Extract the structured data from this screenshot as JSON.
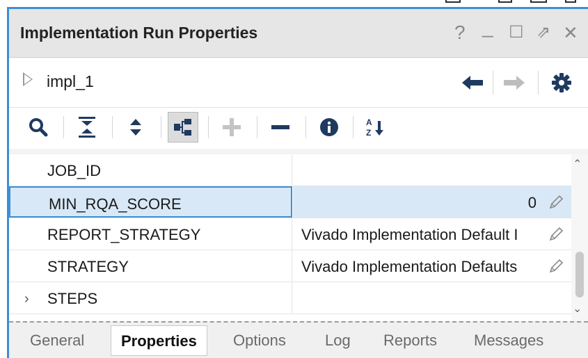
{
  "window": {
    "title": "Implementation Run Properties",
    "help_glyph": "?",
    "minimize_glyph": "_",
    "maximize_glyph": "☐",
    "restore_glyph": "⇗",
    "close_glyph": "✕"
  },
  "header": {
    "run_name": "impl_1",
    "icons": [
      "back-arrow-icon",
      "forward-arrow-icon",
      "gear-icon"
    ]
  },
  "toolbar": {
    "icons": [
      "search-icon",
      "collapse-all-icon",
      "expand-all-icon",
      "group-tree-icon",
      "add-icon",
      "remove-icon",
      "info-icon",
      "sort-alpha-icon"
    ],
    "sort_glyph_top": "A",
    "sort_glyph_bottom": "Z"
  },
  "properties": {
    "rows": [
      {
        "name": "JOB_ID",
        "value": ""
      },
      {
        "name": "MIN_RQA_SCORE",
        "value": "0"
      },
      {
        "name": "REPORT_STRATEGY",
        "value": "Vivado Implementation Default I"
      },
      {
        "name": "STRATEGY",
        "value": "Vivado Implementation Defaults"
      },
      {
        "name": "STEPS",
        "value": ""
      }
    ],
    "selected_row": "MIN_RQA_SCORE"
  },
  "tabs": [
    {
      "label": "General"
    },
    {
      "label": "Properties"
    },
    {
      "label": "Options"
    },
    {
      "label": "Log"
    },
    {
      "label": "Reports"
    },
    {
      "label": "Messages"
    }
  ],
  "active_tab": "Properties",
  "colors": {
    "accent": "#3c8fd6",
    "selection": "#d9e8f7",
    "icon_dark": "#1f3a60"
  }
}
